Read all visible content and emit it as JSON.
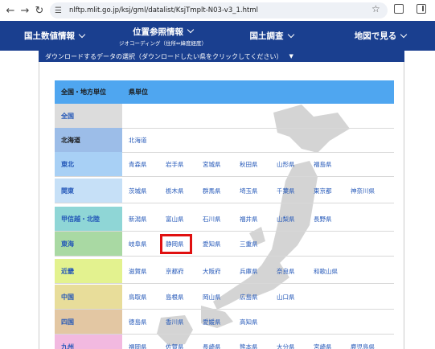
{
  "browser": {
    "url": "nlftp.mlit.go.jp/ksj/gml/datalist/KsjTmplt-N03-v3_1.html",
    "tune_icon": "page-info-icon"
  },
  "nav": {
    "items": [
      {
        "label": "国土数値情報",
        "sub": ""
      },
      {
        "label": "位置参照情報",
        "sub": "ジオコーディング（住所⇔緯度経度）"
      },
      {
        "label": "国土調査",
        "sub": ""
      },
      {
        "label": "地図で見る",
        "sub": ""
      }
    ]
  },
  "select": {
    "label": "ダウンロードするデータの選択（ダウンロードしたい県をクリックしてください）",
    "caret": "▼"
  },
  "table": {
    "header": {
      "region": "全国・地方単位",
      "pref": "県単位"
    },
    "rows": [
      {
        "region": "全国",
        "color": "#dcdcdc",
        "prefs": []
      },
      {
        "region": "北海道",
        "color": "#9cbde8",
        "prefs": [
          "北海道"
        ]
      },
      {
        "region": "東北",
        "color": "#a8d0f5",
        "prefs": [
          "青森県",
          "岩手県",
          "宮城県",
          "秋田県",
          "山形県",
          "福島県"
        ]
      },
      {
        "region": "関東",
        "color": "#c6e0f7",
        "prefs": [
          "茨城県",
          "栃木県",
          "群馬県",
          "埼玉県",
          "千葉県",
          "東京都",
          "神奈川県"
        ]
      },
      {
        "region": "甲信越・北陸",
        "color": "#8fd6d6",
        "prefs": [
          "新潟県",
          "富山県",
          "石川県",
          "福井県",
          "山梨県",
          "長野県"
        ]
      },
      {
        "region": "東海",
        "color": "#a9d9a3",
        "prefs": [
          "岐阜県",
          "静岡県",
          "愛知県",
          "三重県"
        ]
      },
      {
        "region": "近畿",
        "color": "#e3f28f",
        "prefs": [
          "滋賀県",
          "京都府",
          "大阪府",
          "兵庫県",
          "奈良県",
          "和歌山県"
        ]
      },
      {
        "region": "中国",
        "color": "#e8dd9a",
        "prefs": [
          "鳥取県",
          "島根県",
          "岡山県",
          "広島県",
          "山口県"
        ]
      },
      {
        "region": "四国",
        "color": "#e3c7a3",
        "prefs": [
          "徳島県",
          "香川県",
          "愛媛県",
          "高知県"
        ]
      },
      {
        "region": "九州",
        "color": "#f2b9e0",
        "prefs": [
          "福岡県",
          "佐賀県",
          "長崎県",
          "熊本県",
          "大分県",
          "宮崎県",
          "鹿児島県"
        ]
      }
    ],
    "highlighted": "静岡県"
  },
  "colors": {
    "nav_bg": "#1a3f8f",
    "header_row": "#4fa6f0",
    "link": "#2357b8",
    "highlight": "#e01010"
  }
}
